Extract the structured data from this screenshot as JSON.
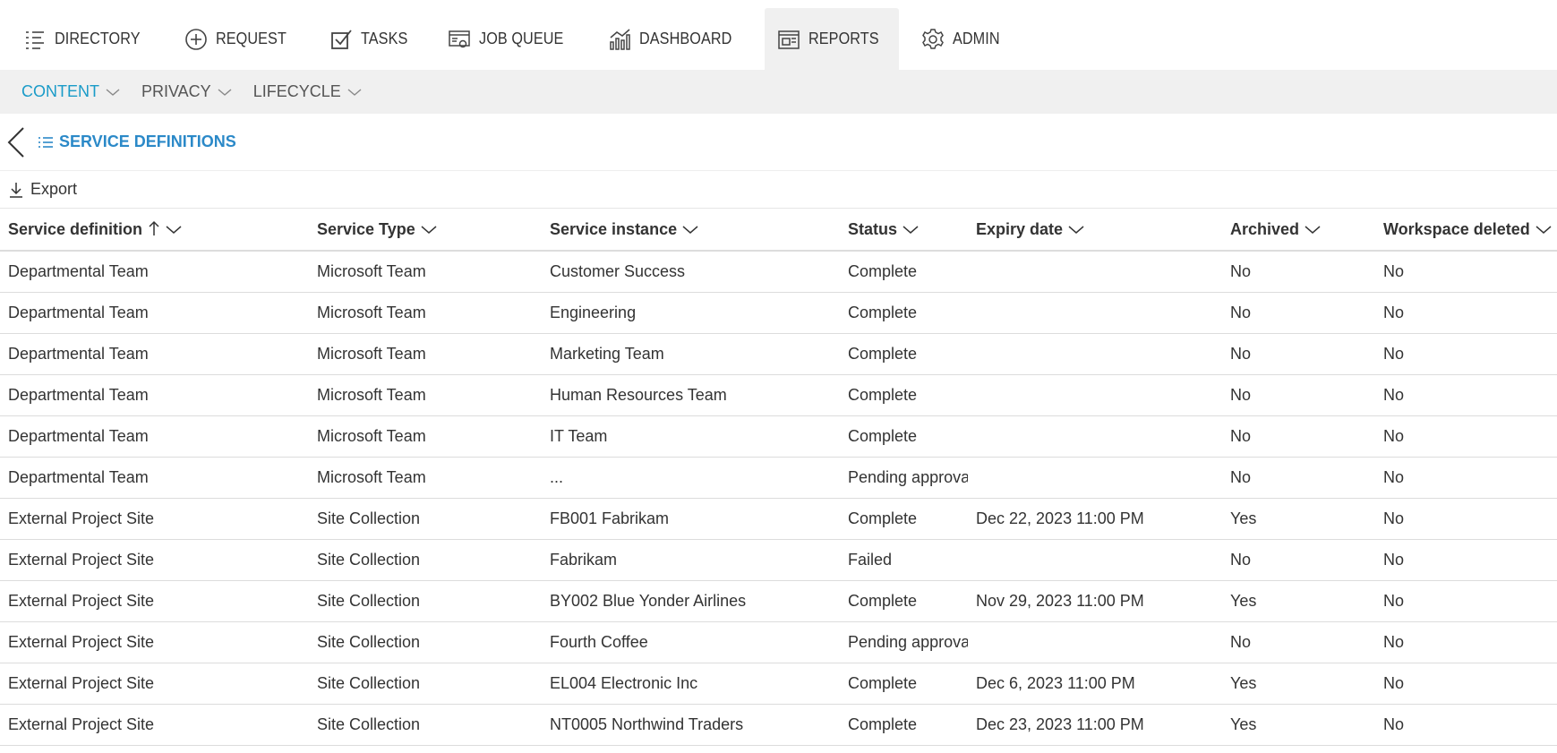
{
  "nav": {
    "items": [
      {
        "label": "DIRECTORY",
        "icon": "list-icon"
      },
      {
        "label": "REQUEST",
        "icon": "plus-circle-icon"
      },
      {
        "label": "TASKS",
        "icon": "checkbox-icon"
      },
      {
        "label": "JOB QUEUE",
        "icon": "job-queue-icon"
      },
      {
        "label": "DASHBOARD",
        "icon": "chart-icon"
      },
      {
        "label": "REPORTS",
        "icon": "reports-icon"
      },
      {
        "label": "ADMIN",
        "icon": "gear-icon"
      }
    ],
    "active": "REPORTS"
  },
  "subnav": {
    "items": [
      {
        "label": "CONTENT"
      },
      {
        "label": "PRIVACY"
      },
      {
        "label": "LIFECYCLE"
      }
    ],
    "active": "CONTENT"
  },
  "breadcrumb": {
    "title": "SERVICE DEFINITIONS"
  },
  "toolbar": {
    "export_label": "Export"
  },
  "table": {
    "columns": [
      {
        "label": "Service definition",
        "sorted": "ascending"
      },
      {
        "label": "Service Type"
      },
      {
        "label": "Service instance"
      },
      {
        "label": "Status"
      },
      {
        "label": "Expiry date"
      },
      {
        "label": "Archived"
      },
      {
        "label": "Workspace deleted"
      }
    ],
    "rows": [
      [
        "Departmental Team",
        "Microsoft Team",
        "Customer Success",
        "Complete",
        "",
        "No",
        "No"
      ],
      [
        "Departmental Team",
        "Microsoft Team",
        "Engineering",
        "Complete",
        "",
        "No",
        "No"
      ],
      [
        "Departmental Team",
        "Microsoft Team",
        "Marketing Team",
        "Complete",
        "",
        "No",
        "No"
      ],
      [
        "Departmental Team",
        "Microsoft Team",
        "Human Resources Team",
        "Complete",
        "",
        "No",
        "No"
      ],
      [
        "Departmental Team",
        "Microsoft Team",
        "IT Team",
        "Complete",
        "",
        "No",
        "No"
      ],
      [
        "Departmental Team",
        "Microsoft Team",
        "...",
        "Pending approval",
        "",
        "No",
        "No"
      ],
      [
        "External Project Site",
        "Site Collection",
        "FB001 Fabrikam",
        "Complete",
        "Dec 22, 2023 11:00 PM",
        "Yes",
        "No"
      ],
      [
        "External Project Site",
        "Site Collection",
        "Fabrikam",
        "Failed",
        "",
        "No",
        "No"
      ],
      [
        "External Project Site",
        "Site Collection",
        "BY002 Blue Yonder Airlines",
        "Complete",
        "Nov 29, 2023 11:00 PM",
        "Yes",
        "No"
      ],
      [
        "External Project Site",
        "Site Collection",
        "Fourth Coffee",
        "Pending approval",
        "",
        "No",
        "No"
      ],
      [
        "External Project Site",
        "Site Collection",
        "EL004 Electronic Inc",
        "Complete",
        "Dec 6, 2023 11:00 PM",
        "Yes",
        "No"
      ],
      [
        "External Project Site",
        "Site Collection",
        "NT0005 Northwind Traders",
        "Complete",
        "Dec 23, 2023 11:00 PM",
        "Yes",
        "No"
      ]
    ]
  },
  "colors": {
    "accent": "#1a9bc8",
    "link": "#2b89c8",
    "subnav_bg": "#f0f0f0",
    "text": "#333333"
  }
}
